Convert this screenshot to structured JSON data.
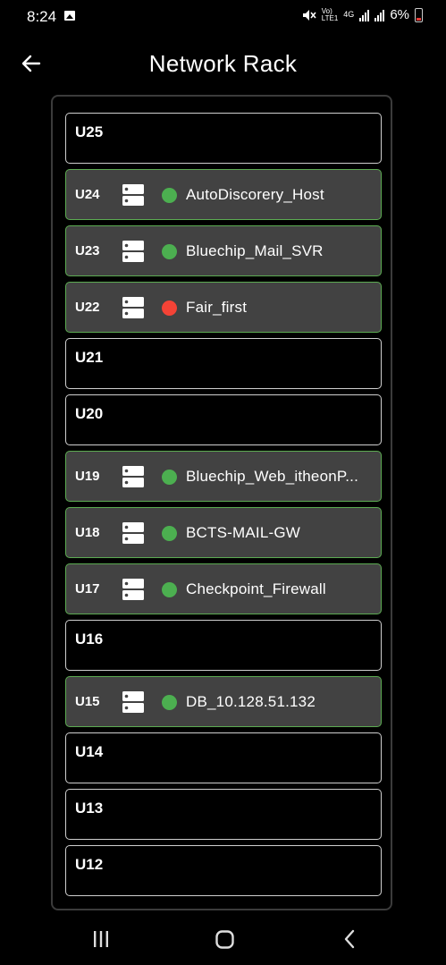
{
  "status_bar": {
    "time": "8:24",
    "volte": "Vo)\nLTE1",
    "network": "4G",
    "battery": "6%",
    "battery_color": "#e53935"
  },
  "header": {
    "title": "Network Rack"
  },
  "colors": {
    "online": "#4caf50",
    "offline": "#f44336",
    "occupied_bg": "#424242",
    "occupied_border": "#5cab52"
  },
  "rack": {
    "slots": [
      {
        "unit": "U25",
        "device": null
      },
      {
        "unit": "U24",
        "device": {
          "name": "AutoDiscorery_Host",
          "status": "online"
        }
      },
      {
        "unit": "U23",
        "device": {
          "name": "Bluechip_Mail_SVR",
          "status": "online"
        }
      },
      {
        "unit": "U22",
        "device": {
          "name": "Fair_first",
          "status": "offline"
        }
      },
      {
        "unit": "U21",
        "device": null
      },
      {
        "unit": "U20",
        "device": null
      },
      {
        "unit": "U19",
        "device": {
          "name": "Bluechip_Web_itheonP...",
          "status": "online"
        }
      },
      {
        "unit": "U18",
        "device": {
          "name": "BCTS-MAIL-GW",
          "status": "online"
        }
      },
      {
        "unit": "U17",
        "device": {
          "name": "Checkpoint_Firewall",
          "status": "online"
        }
      },
      {
        "unit": "U16",
        "device": null
      },
      {
        "unit": "U15",
        "device": {
          "name": "DB_10.128.51.132",
          "status": "online"
        }
      },
      {
        "unit": "U14",
        "device": null
      },
      {
        "unit": "U13",
        "device": null
      },
      {
        "unit": "U12",
        "device": null
      }
    ]
  }
}
